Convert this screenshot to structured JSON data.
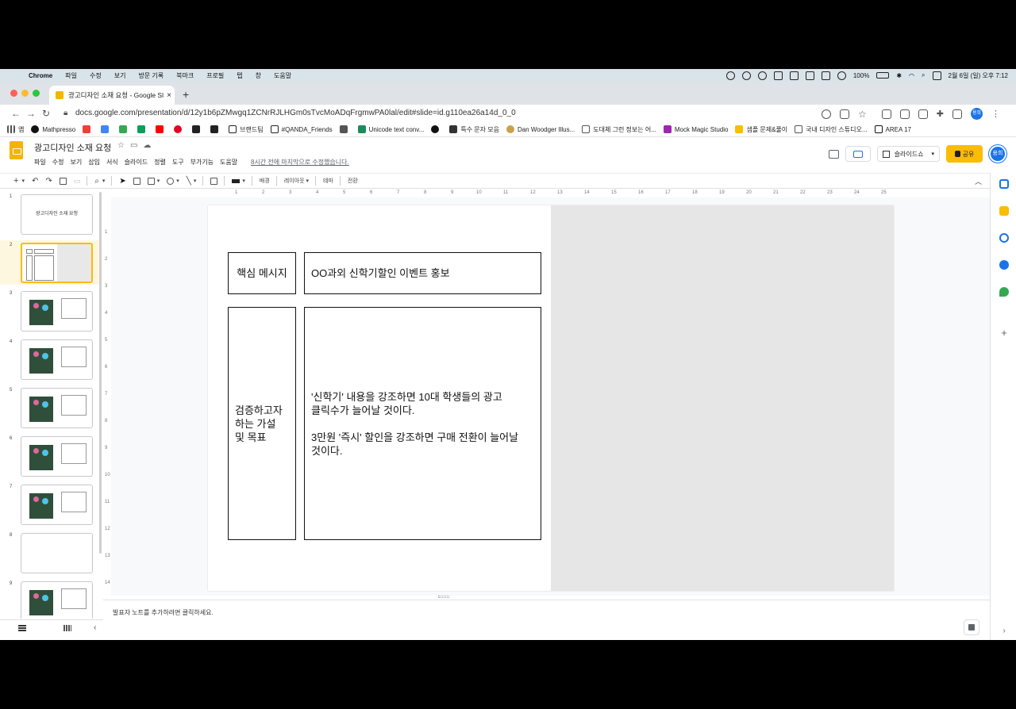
{
  "mac_menubar": {
    "app": "Chrome",
    "menus": [
      "파일",
      "수정",
      "보기",
      "방문 기록",
      "북마크",
      "프로필",
      "탭",
      "창",
      "도움말"
    ],
    "battery": "100%",
    "datetime": "2월 6일 (일) 오후 7:12"
  },
  "browser": {
    "tab_title": "광고디자인 소재 요청 - Google Sli",
    "url": "docs.google.com/presentation/d/12y1b6pZMwgq1ZCNrRJLHGm0sTvcMoADqFrgmwPA0lal/edit#slide=id.g110ea26a14d_0_0",
    "bookmarks": [
      "앱",
      "Mathpresso",
      "브랜드팀",
      "#QANDA_Friends",
      "Unicode text conv...",
      "특수 문자 모음",
      "Dan Woodger Illus...",
      "도대체 그런 정보는 어...",
      "Mock Magic Studio",
      "샘플 문제&풀이",
      "국내 디자인 스튜디오...",
      "AREA 17"
    ]
  },
  "slides_app": {
    "doc_title": "광고디자인 소재 요청",
    "menus": [
      "파일",
      "수정",
      "보기",
      "삽입",
      "서식",
      "슬라이드",
      "정렬",
      "도구",
      "부가기능",
      "도움말"
    ],
    "last_edit": "8시간 전에 마지막으로 수정했습니다.",
    "present_label": "슬라이드쇼",
    "share_label": "공유",
    "avatar_initials": "용희",
    "toolbar_labels": {
      "background": "배경",
      "layout": "레이아웃",
      "theme": "테마",
      "transition": "전환"
    },
    "notes_placeholder": "발표자 노트를 추가하려면 클릭하세요."
  },
  "filmstrip": {
    "slides": [
      {
        "num": "1",
        "text": "광고디자인 소재 요청"
      },
      {
        "num": "2",
        "text": ""
      },
      {
        "num": "3",
        "text": ""
      },
      {
        "num": "4",
        "text": ""
      },
      {
        "num": "5",
        "text": ""
      },
      {
        "num": "6",
        "text": ""
      },
      {
        "num": "7",
        "text": ""
      },
      {
        "num": "8",
        "text": ""
      },
      {
        "num": "9",
        "text": ""
      }
    ],
    "active_slide": "2"
  },
  "ruler": {
    "top": [
      "1",
      "2",
      "3",
      "4",
      "5",
      "6",
      "7",
      "8",
      "9",
      "10",
      "11",
      "12",
      "13",
      "14",
      "15",
      "16",
      "17",
      "18",
      "19",
      "20",
      "21",
      "22",
      "23",
      "24",
      "25"
    ],
    "left": [
      "1",
      "2",
      "3",
      "4",
      "5",
      "6",
      "7",
      "8",
      "9",
      "10",
      "11",
      "12",
      "13",
      "14"
    ]
  },
  "slide": {
    "key_message_label": "핵심 메시지",
    "key_message_text": "OO과외 신학기할인 이벤트 홍보",
    "hypothesis_label": "검증하고자\n하는 가설\n및 목표",
    "hypothesis_p1": "'신학기' 내용을 강조하면 10대 학생들의 광고\n클릭수가 늘어날 것이다.",
    "hypothesis_p2": "3만원 '즉시' 할인을 강조하면 구매 전환이 늘어날\n것이다."
  }
}
